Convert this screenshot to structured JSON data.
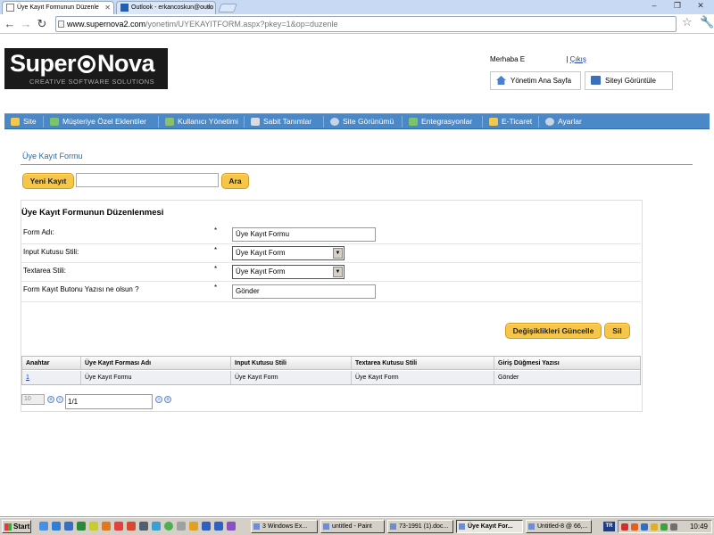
{
  "browser": {
    "tabs": [
      {
        "label": "Üye Kayıt Formunun Düzenle"
      },
      {
        "label": "Outlook - erkancoskun@outlo"
      }
    ],
    "url_host": "www.supernova2.com",
    "url_path": "/yonetim/UYEKAYITFORM.aspx?pkey=1&op=duzenle"
  },
  "header": {
    "logo_brand_left": "Super",
    "logo_brand_right": "Nova",
    "logo_tagline": "CREATIVE SOFTWARE SOLUTIONS",
    "greeting": "Merhaba E",
    "logout_label": "Çıkış",
    "admin_home_label": "Yönetim Ana Sayfa",
    "view_site_label": "Siteyi Görüntüle"
  },
  "menu": {
    "items": [
      {
        "label": "Site"
      },
      {
        "label": "Müşteriye Özel Eklentiler"
      },
      {
        "label": "Kullanıcı Yönetimi"
      },
      {
        "label": "Sabit Tanımlar"
      },
      {
        "label": "Site Görünümü"
      },
      {
        "label": "Entegrasyonlar"
      },
      {
        "label": "E-Ticaret"
      },
      {
        "label": "Ayarlar"
      }
    ]
  },
  "page": {
    "title": "Üye Kayıt Formu",
    "new_record_label": "Yeni Kayıt",
    "search_label": "Ara",
    "search_value": "",
    "section_title": "Üye Kayıt Formunun Düzenlenmesi",
    "required_mark": "*",
    "fields": [
      {
        "label": "Form Adı:",
        "value": "Üye Kayıt Formu"
      },
      {
        "label": "Input Kutusu Stili:",
        "value": "Üye Kayıt Form"
      },
      {
        "label": "Textarea Stili:",
        "value": "Üye Kayıt Form"
      },
      {
        "label": "Form Kayıt Butonu Yazısı ne olsun ?",
        "value": "Gönder"
      }
    ],
    "update_label": "Değişiklikleri Güncelle",
    "delete_label": "Sil"
  },
  "grid": {
    "columns": [
      "Anahtar",
      "Üye Kayıt Forması Adı",
      "Input Kutusu Stili",
      "Textarea Kutusu Stili",
      "Giriş Düğmesi Yazısı"
    ],
    "rows": [
      [
        "1",
        "Üye Kayıt Formu",
        "Üye Kayıt Form",
        "Üye Kayıt Form",
        "Gönder"
      ]
    ]
  },
  "pager": {
    "page_size": "10",
    "page_info": "1/1"
  },
  "taskbar": {
    "start_label": "Start",
    "buttons": [
      {
        "label": "3 Windows Ex..."
      },
      {
        "label": "untitled - Paint"
      },
      {
        "label": "73-1991 (1).doc..."
      },
      {
        "label": "Üye Kayıt For..."
      },
      {
        "label": "Untitled-8 @ 66,..."
      }
    ],
    "lang": "TR",
    "clock": "10:49"
  }
}
